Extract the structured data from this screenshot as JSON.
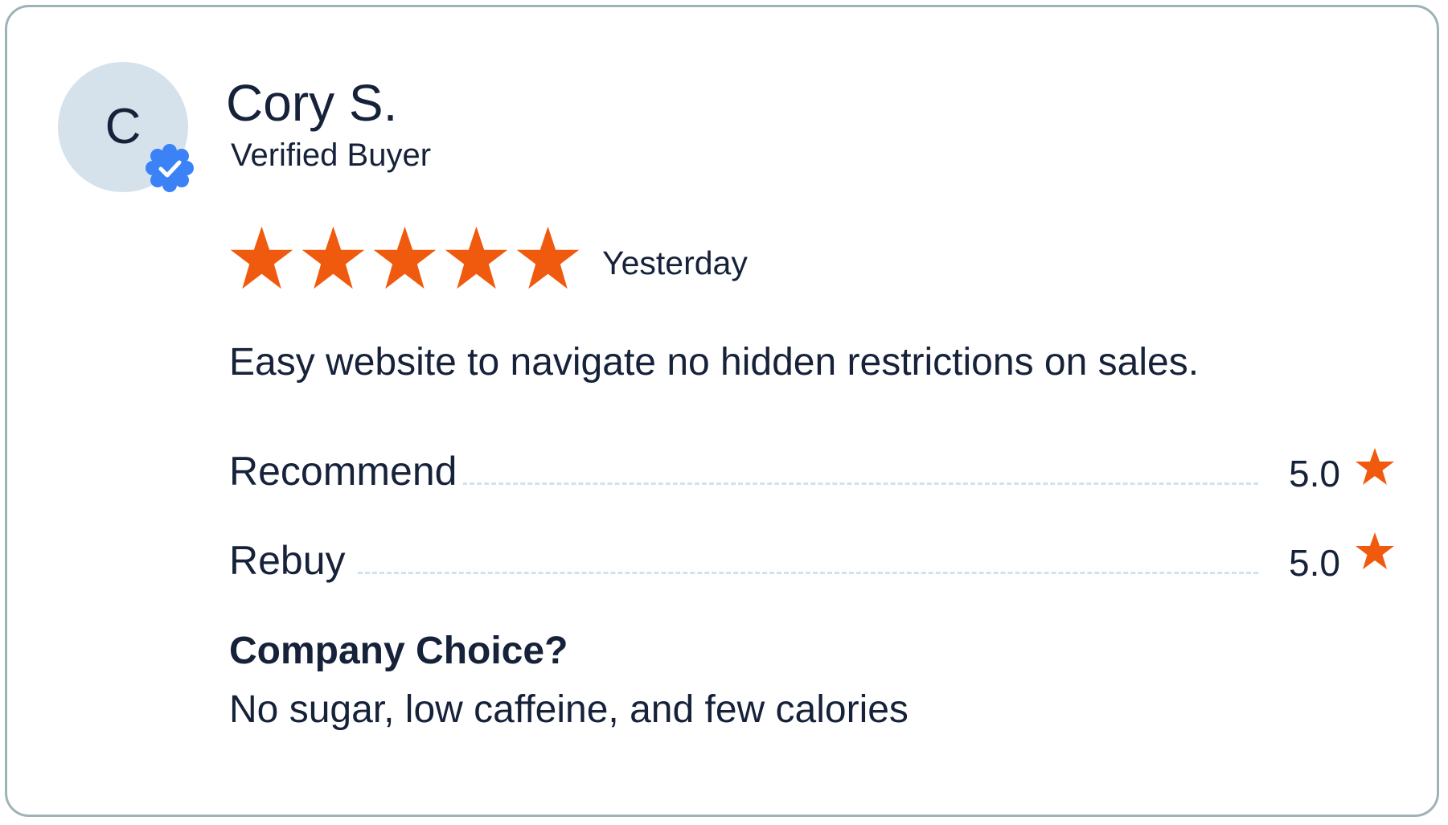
{
  "review": {
    "reviewer": {
      "initial": "C",
      "name": "Cory S.",
      "status": "Verified Buyer",
      "badge_icon": "verified-check-icon",
      "avatar_color": "#d5e2ec",
      "badge_color": "#3b82f6"
    },
    "rating": {
      "stars": 5,
      "max_stars": 5,
      "star_icon": "star-icon",
      "star_color": "#f05a0e"
    },
    "date": "Yesterday",
    "body": "Easy website to navigate no hidden restrictions on sales.",
    "attributes": [
      {
        "label": "Recommend",
        "value": "5.0"
      },
      {
        "label": "Rebuy",
        "value": "5.0"
      }
    ],
    "question": {
      "title": "Company Choice?",
      "answer": "No sugar, low caffeine, and few calories"
    }
  }
}
